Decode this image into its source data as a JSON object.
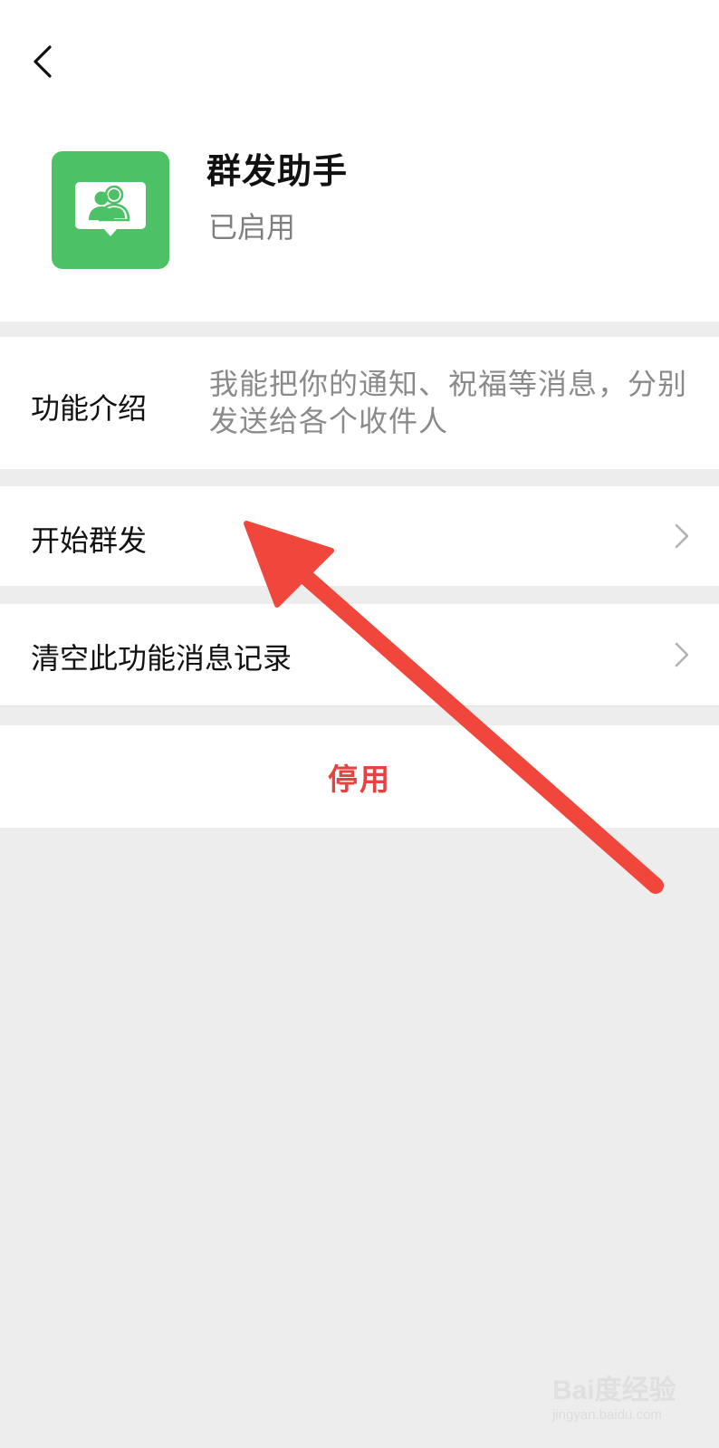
{
  "header": {
    "back_icon": "chevron-left-icon",
    "app_icon": "group-people-icon",
    "app_icon_color": "#4cc165",
    "app_name": "群发助手",
    "app_status": "已启用"
  },
  "intro": {
    "label": "功能介绍",
    "description": "我能把你的通知、祝福等消息，分别发送给各个收件人"
  },
  "rows": [
    {
      "label": "开始群发",
      "icon": "chevron-right-icon"
    },
    {
      "label": "清空此功能消息记录",
      "icon": "chevron-right-icon"
    }
  ],
  "disable": {
    "label": "停用",
    "color": "#e64340"
  },
  "annotation": {
    "type": "red-arrow",
    "color": "#f0463c",
    "points_to": "开始群发"
  },
  "watermark": {
    "logo": "Bai度经验",
    "url": "jingyan.baidu.com"
  }
}
